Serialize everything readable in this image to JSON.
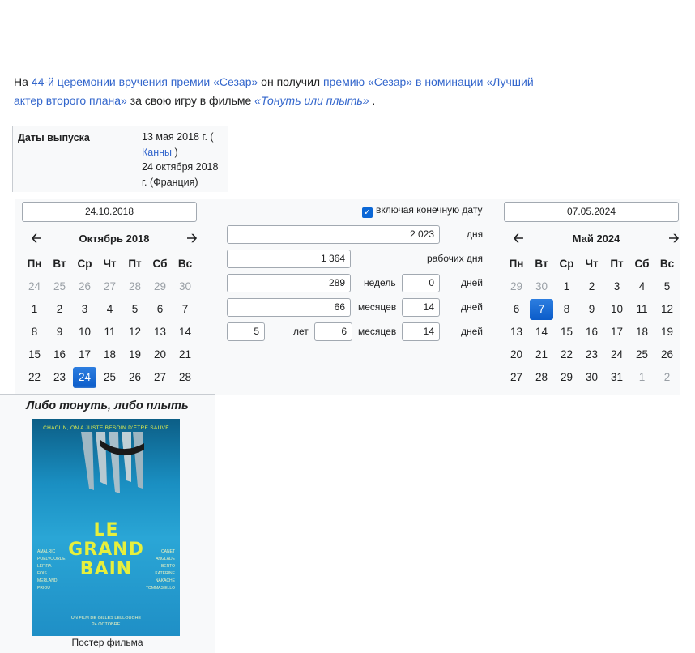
{
  "article": {
    "p1": "На ",
    "link1": "44-й церемонии вручения премии «Сезар»",
    "p2": " он получил ",
    "link2": "премию «Сезар» в номинации «Лучший актер второго плана»",
    "p3": " за свою игру в фильме ",
    "link3": "«Тонуть или плыть»",
    "p4": " ."
  },
  "infobox": {
    "label": "Даты выпуска",
    "line1": "13 мая 2018 г. (",
    "link": "Канны",
    "line1_end": " )",
    "line2": "24 октября 2018 г. (Франция)"
  },
  "calculator": {
    "start_date": "24.10.2018",
    "end_date": "07.05.2024",
    "include_end": "включая конечную дату",
    "days_total": "2 023",
    "days_label": "дня",
    "workdays": "1 364",
    "workdays_label": "рабочих дня",
    "weeks": "289",
    "weeks_label": "недель",
    "weeks_days": "0",
    "weeks_days_label": "дней",
    "months": "66",
    "months_label": "месяцев",
    "months_days": "14",
    "months_days_label": "дней",
    "ymd_years": "5",
    "ymd_years_label": "лет",
    "ymd_months": "6",
    "ymd_months_label": "месяцев",
    "ymd_days": "14",
    "ymd_days_label": "дней",
    "left_cal": {
      "title": "Октябрь 2018",
      "weekdays": [
        "Пн",
        "Вт",
        "Ср",
        "Чт",
        "Пт",
        "Сб",
        "Вс"
      ],
      "days": [
        [
          "24",
          "25",
          "26",
          "27",
          "28",
          "29",
          "30"
        ],
        [
          "1",
          "2",
          "3",
          "4",
          "5",
          "6",
          "7"
        ],
        [
          "8",
          "9",
          "10",
          "11",
          "12",
          "13",
          "14"
        ],
        [
          "15",
          "16",
          "17",
          "18",
          "19",
          "20",
          "21"
        ],
        [
          "22",
          "23",
          "24",
          "25",
          "26",
          "27",
          "28"
        ]
      ],
      "selected": "24"
    },
    "right_cal": {
      "title": "Май 2024",
      "weekdays": [
        "Пн",
        "Вт",
        "Ср",
        "Чт",
        "Пт",
        "Сб",
        "Вс"
      ],
      "days": [
        [
          "29",
          "30",
          "1",
          "2",
          "3",
          "4",
          "5"
        ],
        [
          "6",
          "7",
          "8",
          "9",
          "10",
          "11",
          "12"
        ],
        [
          "13",
          "14",
          "15",
          "16",
          "17",
          "18",
          "19"
        ],
        [
          "20",
          "21",
          "22",
          "23",
          "24",
          "25",
          "26"
        ],
        [
          "27",
          "28",
          "29",
          "30",
          "31",
          "1",
          "2"
        ]
      ],
      "selected": "7"
    }
  },
  "poster": {
    "heading": "Либо тонуть, либо плыть",
    "tagline": "CHACUN, ON A JUSTE BESOIN D'ÊTRE SAUVÉ",
    "title_l1": "LE",
    "title_l2": "GRAND",
    "title_l3": "BAIN",
    "director": "UN FILM DE GILLES LELLOUCHE",
    "date": "24 OCTOBRE",
    "caption": "Постер фильма"
  }
}
